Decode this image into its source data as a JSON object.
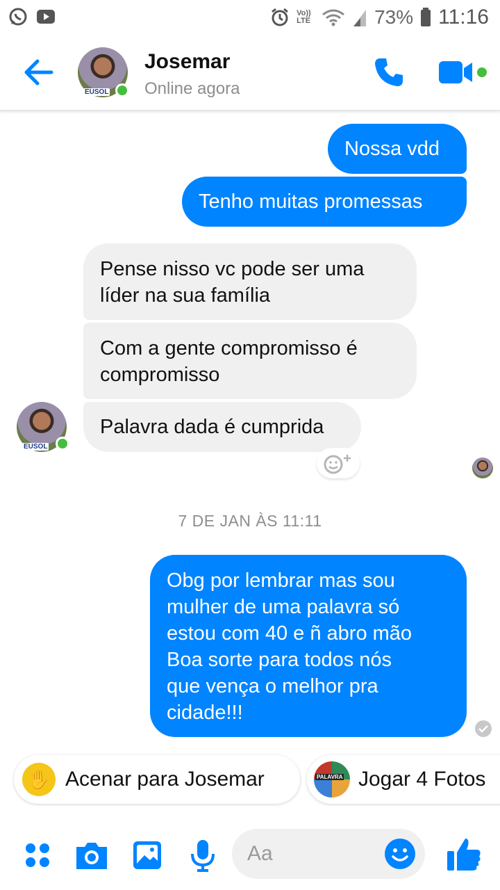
{
  "status_bar": {
    "volte": "Vo)) LTE",
    "battery": "73%",
    "time": "11:16"
  },
  "header": {
    "contact_name": "Josemar",
    "contact_status": "Online agora",
    "avatar_badge": "EUSOL"
  },
  "messages": [
    {
      "direction": "out",
      "text": "Nossa vdd"
    },
    {
      "direction": "out",
      "text": "Tenho muitas promessas"
    },
    {
      "direction": "in",
      "lines": [
        "Pense nisso vc pode ser uma",
        "líder na sua família"
      ]
    },
    {
      "direction": "in",
      "lines": [
        "Com a gente compromisso é",
        "compromisso"
      ]
    },
    {
      "direction": "in",
      "text": "Palavra dada é cumprida"
    },
    {
      "direction": "out",
      "lines": [
        "Obg por lembrar mas sou",
        "mulher de uma palavra só",
        "estou com 40 e ñ abro mão",
        "Boa sorte para todos nós",
        "que vença o melhor pra",
        "cidade!!!"
      ]
    }
  ],
  "timestamp": "7 DE JAN ÀS 11:11",
  "suggestions": [
    {
      "label": "Acenar para Josemar",
      "icon": "wave-hand-icon"
    },
    {
      "label": "Jogar 4 Fotos",
      "icon": "palavra-game-icon",
      "icon_text": "PALAVRA"
    }
  ],
  "composer": {
    "placeholder": "Aa"
  },
  "colors": {
    "accent": "#0084ff",
    "incoming_bubble": "#f1f0f0",
    "online": "#45bd3e"
  }
}
